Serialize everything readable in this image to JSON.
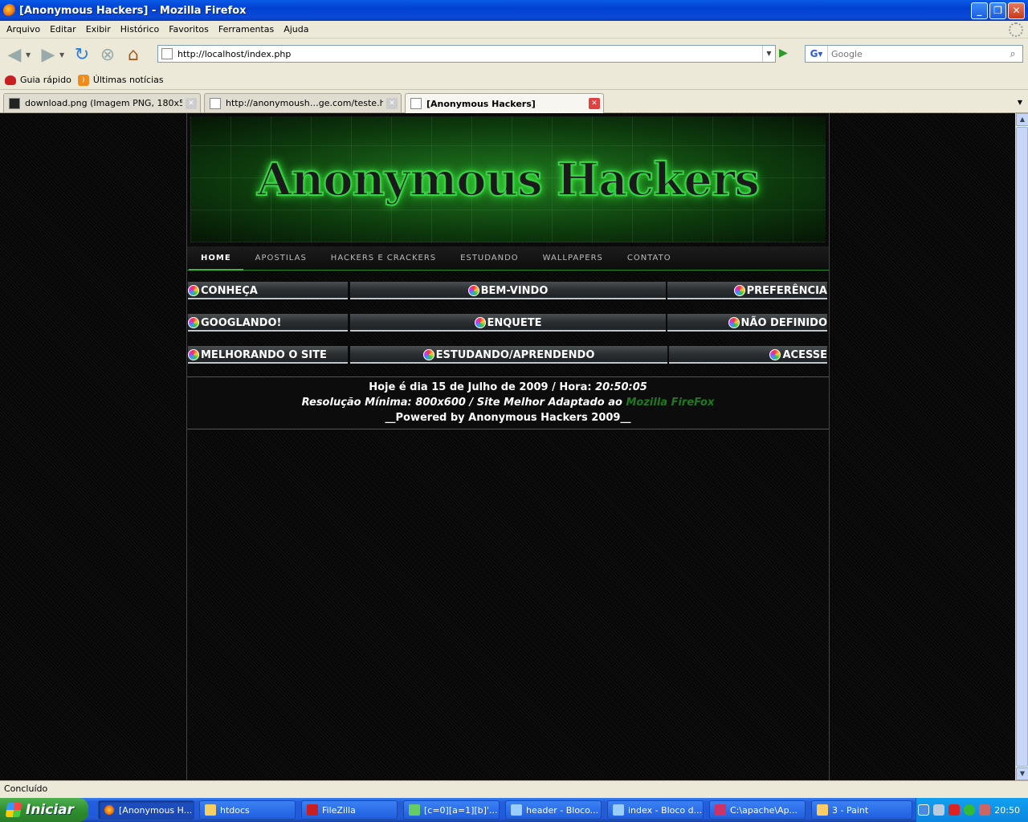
{
  "window": {
    "title": "[Anonymous Hackers] - Mozilla Firefox"
  },
  "menu": [
    "Arquivo",
    "Editar",
    "Exibir",
    "Histórico",
    "Favoritos",
    "Ferramentas",
    "Ajuda"
  ],
  "nav": {
    "url": "http://localhost/index.php",
    "search_placeholder": "Google"
  },
  "bookmarks": [
    "Guia rápido",
    "Últimas notícias"
  ],
  "tabs": [
    {
      "title": "download.png (Imagem PNG, 180x54 ..."
    },
    {
      "title": "http://anonymoush…ge.com/teste.html"
    },
    {
      "title": "[Anonymous Hackers]"
    }
  ],
  "site": {
    "banner_title": "Anonymous Hackers",
    "menu": [
      "HOME",
      "APOSTILAS",
      "HACKERS E CRACKERS",
      "ESTUDANDO",
      "WALLPAPERS",
      "CONTATO"
    ],
    "boxes": [
      [
        "CONHEÇA",
        "BEM-VINDO",
        "PREFERÊNCIA"
      ],
      [
        "GOOGLANDO!",
        "ENQUETE",
        "NÃO DEFINIDO"
      ],
      [
        "MELHORANDO O SITE",
        "ESTUDANDO/APRENDENDO",
        "ACESSE"
      ]
    ],
    "footer": {
      "date_prefix": "Hoje é dia 15 de Julho de 2009 / Hora:",
      "time": "20:50:05",
      "resolution": "Resolução Mínima: 800x600 / Site Melhor Adaptado ao",
      "browser_link": "Mozilla FireFox",
      "powered": "__Powered by Anonymous Hackers 2009__"
    }
  },
  "status": "Concluído",
  "taskbar": {
    "start": "Iniciar",
    "items": [
      "[Anonymous H...",
      "htdocs",
      "FileZilla",
      "[c=0][a=1][b]'...",
      "header - Bloco...",
      "index - Bloco d...",
      "C:\\apache\\Ap...",
      "3 - Paint"
    ],
    "clock": "20:50"
  }
}
